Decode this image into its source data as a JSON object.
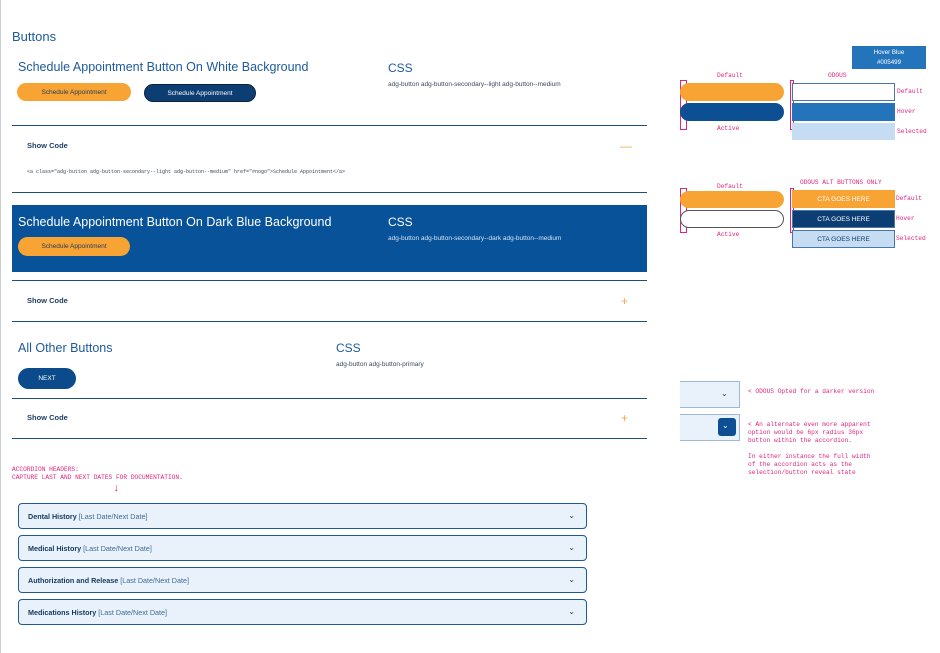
{
  "page": {
    "title": "Buttons"
  },
  "section_white": {
    "title": "Schedule Appointment Button On White Background",
    "css_heading": "CSS",
    "css_classes": "adg-button adg-button-secondary--light adg-button--medium",
    "button_primary": "Schedule Appointment",
    "button_secondary": "Schedule Appointment",
    "show_code": "Show Code",
    "toggle": "—",
    "code": "<a class=\"adg-button adg-button-secondary--light adg-button--medium\" href=\"#nogo\">Schedule Appointment</a>"
  },
  "section_dark": {
    "title": "Schedule Appointment Button On Dark Blue Background",
    "css_heading": "CSS",
    "css_classes": "adg-button adg-button-secondary--dark adg-button--medium",
    "button": "Schedule Appointment",
    "show_code": "Show Code",
    "toggle": "+"
  },
  "section_other": {
    "title": "All Other Buttons",
    "css_heading": "CSS",
    "css_classes": "adg-button adg-button-primary",
    "button": "NEXT",
    "show_code": "Show Code",
    "toggle": "+"
  },
  "annotations": {
    "hover_blue_title": "Hover Blue",
    "hover_blue_hex": "#005499",
    "default": "Default",
    "odous": "ODOUS",
    "active": "Active",
    "hover": "Hover",
    "selected": "Selected",
    "default2": "Default",
    "odous_alt": "ODOUS ALT BUTTONS ONLY",
    "active2": "Active",
    "default3": "Default",
    "hover2": "Hover",
    "selected2": "Selected",
    "cta1": "CTA GOES HERE",
    "cta2": "CTA GOES HERE",
    "cta3": "CTA GOES HERE",
    "note1": "< ODOUS Opted for a darker version",
    "note2_lines": [
      "< An alternate even more apparent",
      "option would be 6px radius 36px",
      "button within the accordion."
    ],
    "note3_lines": [
      "In either instance the full width",
      "of the accordion acts as the",
      "selection/button reveal state"
    ],
    "accordion_header_note": [
      "ACCORDION HEADERS:",
      "CAPTURE LAST AND NEXT DATES FOR DOCUMENTATION."
    ],
    "arrow": "↓"
  },
  "accordion": [
    {
      "label": "Dental History",
      "dates": "[Last Date/Next Date]"
    },
    {
      "label": "Medical History",
      "dates": "[Last Date/Next Date]"
    },
    {
      "label": "Authorization and Release",
      "dates": "[Last Date/Next Date]"
    },
    {
      "label": "Medications History",
      "dates": "[Last Date/Next Date]"
    }
  ],
  "icons": {
    "chevron": "chevron-down-icon",
    "plus": "plus-icon",
    "minus": "minus-icon"
  },
  "colors": {
    "navy": "#0C3D73",
    "blue_band": "#075299",
    "orange": "#F8A435",
    "hover_blue": "#005499",
    "annotation": "#E0247E",
    "accordion_bg": "#E9F2FB"
  }
}
